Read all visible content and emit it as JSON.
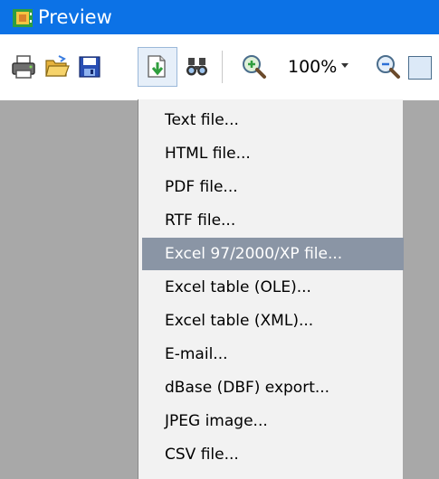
{
  "window": {
    "title": "Preview",
    "icon": "preview-app-icon"
  },
  "toolbar": {
    "buttons": [
      {
        "name": "print-icon"
      },
      {
        "name": "open-folder-icon"
      },
      {
        "name": "save-icon"
      },
      {
        "name": "export-icon"
      },
      {
        "name": "find-icon"
      },
      {
        "name": "zoom-in-icon"
      },
      {
        "name": "zoom-out-icon"
      }
    ],
    "zoom_value": "100%"
  },
  "menu": {
    "items": [
      {
        "label": "Text file..."
      },
      {
        "label": "HTML file..."
      },
      {
        "label": "PDF file..."
      },
      {
        "label": "RTF file..."
      },
      {
        "label": "Excel 97/2000/XP file...",
        "selected": true
      },
      {
        "label": "Excel table (OLE)..."
      },
      {
        "label": "Excel table (XML)..."
      },
      {
        "label": "E-mail..."
      },
      {
        "label": "dBase (DBF) export..."
      },
      {
        "label": "JPEG image..."
      },
      {
        "label": "CSV file..."
      }
    ]
  },
  "colors": {
    "titlebar": "#0c72e6",
    "menu_bg": "#f2f2f2",
    "selection": "#8a95a5",
    "preview_bg": "#a8a8a8"
  }
}
